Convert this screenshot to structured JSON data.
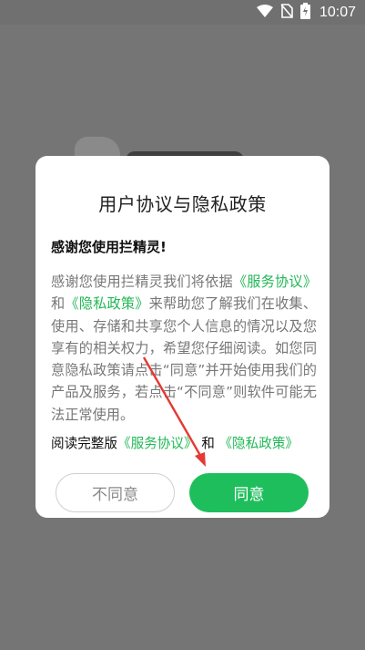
{
  "status_bar": {
    "time": "10:07",
    "icons": [
      "wifi-icon",
      "no-sim-icon",
      "battery-charging-icon"
    ]
  },
  "dialog": {
    "title": "用户协议与隐私政策",
    "greeting": "感谢您使用拦精灵!",
    "body": {
      "part1": "感谢您使用拦精灵我们将依据",
      "link1": "《服务协议》",
      "and1": "和",
      "link2": "《隐私政策》",
      "part2": "来帮助您了解我们在收集、使用、存储和共享您个人信息的情况以及您享有的相关权力，希望您仔细阅读。如您同意隐私政策请点击“同意”并开始使用我们的产品及服务，若点击“不同意”则软件可能无法正常使用。"
    },
    "full_version": {
      "prefix": "阅读完整版",
      "link1": "《服务协议》",
      "and": "和",
      "link2": "《隐私政策》"
    },
    "buttons": {
      "disagree": "不同意",
      "agree": "同意"
    }
  },
  "colors": {
    "accent": "#1fbe5c",
    "annotation_arrow": "#e53935"
  }
}
